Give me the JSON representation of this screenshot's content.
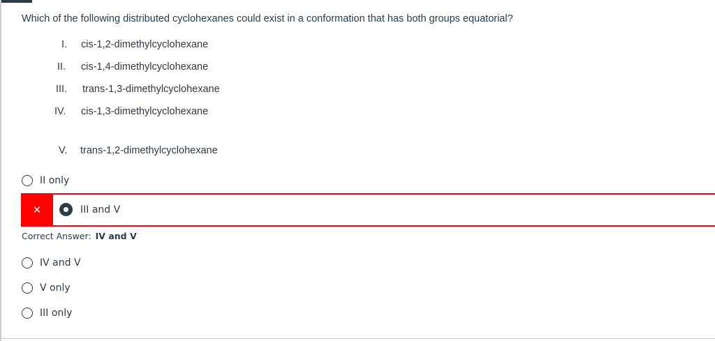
{
  "question": {
    "text": "Which of the following distributed cyclohexanes could exist in a conformation that has both groups equatorial?",
    "statements": [
      {
        "numeral": "I.",
        "text": "cis-1,2-dimethylcyclohexane"
      },
      {
        "numeral": "II.",
        "text": "cis-1,4-dimethylcyclohexane"
      },
      {
        "numeral": "III.",
        "text": "trans-1,3-dimethylcyclohexane"
      },
      {
        "numeral": "IV.",
        "text": "cis-1,3-dimethylcyclohexane"
      },
      {
        "numeral": "V.",
        "text": "trans-1,2-dimethylcyclohexane"
      }
    ]
  },
  "answers": {
    "a": {
      "label": "II only"
    },
    "selected": {
      "label": "III and V",
      "status": "incorrect",
      "flag_icon": "close-icon"
    },
    "c": {
      "label": "IV and V"
    },
    "d": {
      "label": "V only"
    },
    "e": {
      "label": "III only"
    }
  },
  "feedback": {
    "correct_label": "Correct Answer:",
    "correct_value": "IV and V"
  },
  "colors": {
    "incorrect_red": "#ff0000",
    "text": "#2d3b45"
  }
}
